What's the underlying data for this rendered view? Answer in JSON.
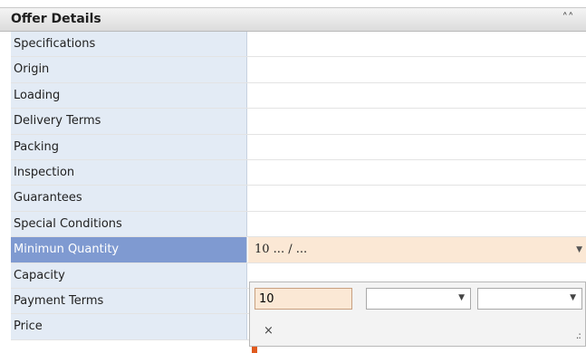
{
  "panel": {
    "title": "Offer Details",
    "collapse_icon": "double-chevron-up-icon"
  },
  "rows": [
    {
      "label": "Specifications",
      "value": ""
    },
    {
      "label": "Origin",
      "value": ""
    },
    {
      "label": "Loading",
      "value": ""
    },
    {
      "label": "Delivery Terms",
      "value": ""
    },
    {
      "label": "Packing",
      "value": ""
    },
    {
      "label": "Inspection",
      "value": ""
    },
    {
      "label": "Guarantees",
      "value": ""
    },
    {
      "label": "Special Conditions",
      "value": ""
    },
    {
      "label": "Minimun Quantity",
      "value": "10 ... / ..."
    },
    {
      "label": "Capacity",
      "value": ""
    },
    {
      "label": "Payment Terms",
      "value": ""
    },
    {
      "label": "Price",
      "value": ""
    }
  ],
  "editor": {
    "quantity_value": "10",
    "unit_select_value": "",
    "per_select_value": "",
    "clear_glyph": "×"
  },
  "colors": {
    "label_bg": "#e3ebf5",
    "selected_label_bg": "#7f9ad1",
    "selected_value_bg": "#fbe8d5"
  }
}
